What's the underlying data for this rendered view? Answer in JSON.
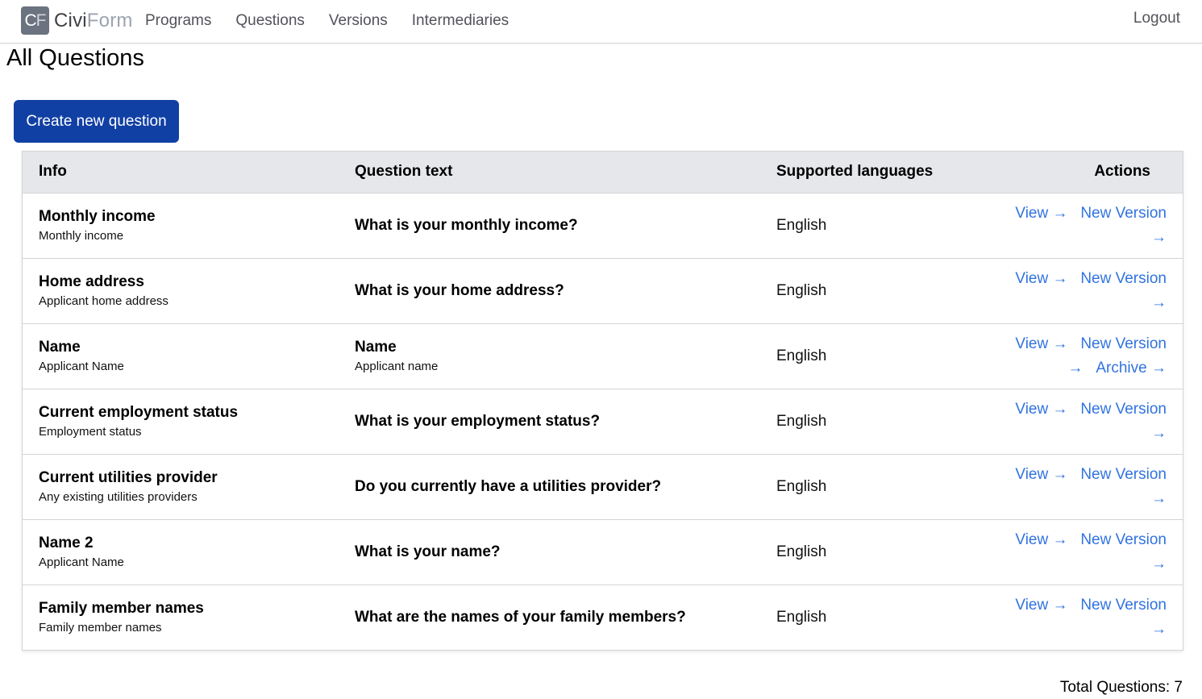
{
  "brand": {
    "logo_c": "C",
    "logo_f": "F",
    "name_a": "Civi",
    "name_b": "Form"
  },
  "nav": [
    "Programs",
    "Questions",
    "Versions",
    "Intermediaries"
  ],
  "logout": "Logout",
  "page_title": "All Questions",
  "create_button": "Create new question",
  "table": {
    "headers": {
      "info": "Info",
      "text": "Question text",
      "languages": "Supported languages",
      "actions": "Actions"
    },
    "rows": [
      {
        "name": "Monthly income",
        "description": "Monthly income",
        "text": "What is your monthly income?",
        "help": "",
        "languages": "English",
        "view": "View →",
        "new_version": "New Version →",
        "archive": ""
      },
      {
        "name": "Home address",
        "description": "Applicant home address",
        "text": "What is your home address?",
        "help": "",
        "languages": "English",
        "view": "View →",
        "new_version": "New Version →",
        "archive": ""
      },
      {
        "name": "Name",
        "description": "Applicant Name",
        "text": "Name",
        "help": "Applicant name",
        "languages": "English",
        "view": "View →",
        "new_version": "New Version →",
        "archive": "Archive →"
      },
      {
        "name": "Current employment status",
        "description": "Employment status",
        "text": "What is your employment status?",
        "help": "",
        "languages": "English",
        "view": "View →",
        "new_version": "New Version →",
        "archive": ""
      },
      {
        "name": "Current utilities provider",
        "description": "Any existing utilities providers",
        "text": "Do you currently have a utilities provider?",
        "help": "",
        "languages": "English",
        "view": "View →",
        "new_version": "New Version →",
        "archive": ""
      },
      {
        "name": "Name 2",
        "description": "Applicant Name",
        "text": "What is your name?",
        "help": "",
        "languages": "English",
        "view": "View →",
        "new_version": "New Version →",
        "archive": ""
      },
      {
        "name": "Family member names",
        "description": "Family member names",
        "text": "What are the names of your family members?",
        "help": "",
        "languages": "English",
        "view": "View →",
        "new_version": "New Version →",
        "archive": ""
      }
    ]
  },
  "total": "Total Questions: 7",
  "colors": {
    "primary_button": "#1140a4",
    "link": "#3173e0",
    "header_bg": "#e5e7eb"
  }
}
